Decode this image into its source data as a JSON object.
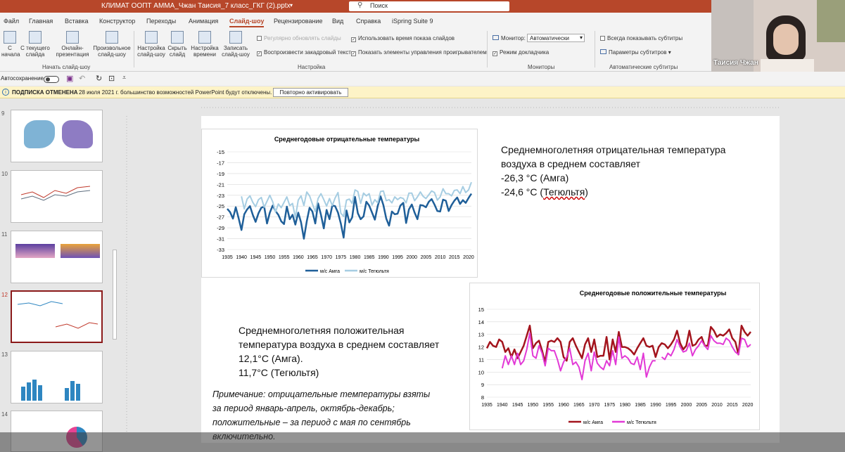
{
  "window": {
    "title": "КЛИМАТ ООПТ АММА_Чжан Таисия_7 класс_ГКГ (2).pptx",
    "search_placeholder": "Поиск"
  },
  "menu": {
    "tabs": [
      "Файл",
      "Главная",
      "Вставка",
      "Конструктор",
      "Переходы",
      "Анимация",
      "Слайд-шоу",
      "Рецензирование",
      "Вид",
      "Справка",
      "iSpring Suite 9"
    ],
    "active": "Слайд-шоу"
  },
  "ribbon": {
    "buttons": {
      "from_start": "С начала",
      "from_current": "С текущего слайда",
      "online": "Онлайн-презентация",
      "custom": "Произвольное слайд-шоу",
      "setup": "Настройка слайд-шоу",
      "hide": "Скрыть слайд",
      "rehearse": "Настройка времени",
      "record": "Записать слайд-шоу"
    },
    "checks": {
      "update": "Регулярно обновлять слайды",
      "voice": "Воспроизвести закадровый текст",
      "timings": "Использовать время показа слайдов",
      "controls": "Показать элементы управления проигрывателем",
      "monitor_label": "Монитор:",
      "monitor_value": "Автоматически",
      "presenter": "Режим докладчика",
      "subtitles": "Всегда показывать субтитры",
      "subtitle_params": "Параметры субтитров"
    },
    "groups": {
      "start": "Начать слайд-шоу",
      "setup": "Настройка",
      "monitors": "Мониторы",
      "subtitles": "Автоматические субтитры"
    }
  },
  "qat": {
    "autosave": "Автосохранение"
  },
  "notification": {
    "title": "ПОДПИСКА ОТМЕНЕНА",
    "message": "28 июля 2021 г. большинство возможностей PowerPoint будут отключены.",
    "button": "Повторно активировать"
  },
  "webcam": {
    "name": "Таисия Чжан"
  },
  "thumbnails": {
    "numbers": [
      "9",
      "10",
      "11",
      "12",
      "13",
      "14"
    ]
  },
  "slide": {
    "text_negative": [
      "Среднемноголетняя  отрицательная температура",
      "воздуха  в среднем составляет",
      "-26,3 °С  (Амга)",
      "-24,6 °С (Тегюльтя)"
    ],
    "text_positive": [
      "Среднемноголетняя  положительная",
      "температура воздуха в среднем составляет",
      "12,1°С (Амга).",
      "11,7°С (Тегюльтя)"
    ],
    "note": [
      "Примечание: отрицательные температуры взяты",
      "за период январь-апрель, октябрь-декабрь;",
      "положительные – за период с мая по сентябрь",
      "включительно."
    ]
  },
  "chart_data": [
    {
      "type": "line",
      "title": "Среднегодовые отрицательные температуры",
      "xlabel": "",
      "ylabel": "",
      "x_start": 1935,
      "x_end": 2021,
      "x_ticks": [
        1935,
        1940,
        1945,
        1950,
        1955,
        1960,
        1965,
        1970,
        1975,
        1980,
        1985,
        1990,
        1995,
        2000,
        2005,
        2010,
        2015,
        2020
      ],
      "ylim": [
        -33,
        -15
      ],
      "y_ticks": [
        -15,
        -17,
        -19,
        -21,
        -23,
        -25,
        -27,
        -29,
        -31,
        -33
      ],
      "grid": true,
      "legend": "bottom",
      "series": [
        {
          "name": "м/с Амга",
          "color": "#1f5f99",
          "width": 2.5,
          "values": [
            -25.5,
            -26.1,
            -27.3,
            -25.2,
            -27.2,
            -29.4,
            -26.5,
            -25.6,
            -25.0,
            -26.6,
            -27.9,
            -26.3,
            -25.3,
            -25.1,
            -28.2,
            -26.2,
            -24.9,
            -25.9,
            -26.6,
            -27.8,
            -28.3,
            -25.1,
            -27.4,
            -26.6,
            -28.4,
            -26.2,
            -28.0,
            -31.0,
            -27.8,
            -25.3,
            -26.0,
            -28.2,
            -24.5,
            -26.6,
            -29.1,
            -25.7,
            -27.4,
            -24.9,
            -25.0,
            -26.2,
            -28.2,
            -30.8,
            -25.8,
            -28.0,
            -27.1,
            -23.3,
            -26.3,
            -27.4,
            -26.9,
            -24.2,
            -24.9,
            -26.2,
            -27.5,
            -25.0,
            -23.2,
            -24.8,
            -27.3,
            -28.6,
            -26.0,
            -26.5,
            -26.4,
            -24.9,
            -24.4,
            -28.1,
            -25.6,
            -24.7,
            -26.2,
            -27.4,
            -24.8,
            -24.9,
            -25.2,
            -24.2,
            -23.7,
            -24.7,
            -25.9,
            -26.0,
            -23.8,
            -24.0,
            -25.9,
            -24.8,
            -24.0,
            -23.4,
            -24.6,
            -23.9,
            -24.4,
            -23.5,
            -22.7
          ]
        },
        {
          "name": "м/с Тегюльтя",
          "color": "#a6cde2",
          "width": 2,
          "values": [
            null,
            null,
            null,
            null,
            null,
            -23.2,
            -25.5,
            -23.7,
            -23.1,
            -24.3,
            -25.1,
            -23.8,
            -23.4,
            -25.2,
            -24.1,
            -23.0,
            -24.2,
            -26.1,
            -24.6,
            -25.3,
            -24.3,
            -23.3,
            -24.9,
            -24.5,
            -27.1,
            -23.9,
            -23.1,
            -24.9,
            -22.4,
            -23.1,
            -24.6,
            -26.0,
            -23.6,
            -22.7,
            -23.8,
            -25.0,
            -23.6,
            -24.9,
            -23.5,
            -22.5,
            -26.3,
            -26.9,
            -23.9,
            -23.7,
            -24.5,
            -22.0,
            -22.3,
            -24.5,
            -22.6,
            -23.1,
            -22.7,
            -24.8,
            -23.8,
            -24.4,
            -22.3,
            -22.2,
            -24.0,
            -23.8,
            -24.4,
            -23.3,
            -23.8,
            -23.4,
            -23.6,
            -24.4,
            -22.6,
            -22.6,
            -24.0,
            -23.3,
            -22.4,
            -23.2,
            -23.6,
            -22.9,
            -22.2,
            -22.5,
            -23.9,
            -23.3,
            -21.8,
            -22.7,
            -22.7,
            -23.1,
            -22.1,
            -22.0,
            -22.7,
            -21.4,
            -22.5,
            -22.0,
            -20.6
          ]
        }
      ]
    },
    {
      "type": "line",
      "title": "Среднегодовые положительные температуры",
      "xlabel": "",
      "ylabel": "",
      "x_start": 1935,
      "x_end": 2021,
      "x_ticks": [
        1935,
        1940,
        1945,
        1950,
        1955,
        1960,
        1965,
        1970,
        1975,
        1980,
        1985,
        1990,
        1995,
        2000,
        2005,
        2010,
        2015,
        2020
      ],
      "ylim": [
        8,
        15
      ],
      "y_ticks": [
        8,
        9,
        10,
        11,
        12,
        13,
        14,
        15
      ],
      "grid": true,
      "legend": "bottom",
      "series": [
        {
          "name": "м/с Амга",
          "color": "#a3141d",
          "width": 2.5,
          "values": [
            11.9,
            12.4,
            12.1,
            12.0,
            12.6,
            12.4,
            11.6,
            11.9,
            11.2,
            11.8,
            11.1,
            11.6,
            12.1,
            12.9,
            13.7,
            11.9,
            12.3,
            12.5,
            11.7,
            10.8,
            12.4,
            12.5,
            12.4,
            12.7,
            12.4,
            11.2,
            10.9,
            12.4,
            12.7,
            12.1,
            11.6,
            11.1,
            12.2,
            12.7,
            11.6,
            12.6,
            11.2,
            11.3,
            11.3,
            12.8,
            11.0,
            12.6,
            11.6,
            13.2,
            12.0,
            12.0,
            11.9,
            11.7,
            11.4,
            11.9,
            12.3,
            12.7,
            12.1,
            12.0,
            12.1,
            11.2,
            12.0,
            12.3,
            12.2,
            11.9,
            12.2,
            12.6,
            13.3,
            12.3,
            11.8,
            12.1,
            13.3,
            12.1,
            12.2,
            12.6,
            12.8,
            12.1,
            12.1,
            13.6,
            13.3,
            12.8,
            13.0,
            12.9,
            13.1,
            13.4,
            12.7,
            12.4,
            11.4,
            13.7,
            13.2,
            12.9,
            13.2
          ]
        },
        {
          "name": "м/с Тегюльтя",
          "color": "#e239d6",
          "width": 2,
          "values": [
            null,
            null,
            null,
            null,
            null,
            10.3,
            11.3,
            10.6,
            11.3,
            10.6,
            11.5,
            10.6,
            10.9,
            11.8,
            13.1,
            11.3,
            11.1,
            12.1,
            11.5,
            10.5,
            11.9,
            11.7,
            11.7,
            11.0,
            10.1,
            10.8,
            11.2,
            11.9,
            10.6,
            10.8,
            10.4,
            9.4,
            10.9,
            11.5,
            10.1,
            11.6,
            10.7,
            10.4,
            10.2,
            10.9,
            10.5,
            11.7,
            10.6,
            12.8,
            11.1,
            11.3,
            11.1,
            10.7,
            10.6,
            11.2,
            10.2,
            11.5,
            9.6,
            10.4,
            10.9,
            10.9,
            null,
            11.2,
            11.0,
            11.5,
            11.3,
            11.8,
            12.6,
            12.0,
            11.6,
            11.7,
            12.3,
            11.3,
            11.8,
            12.1,
            12.5,
            12.1,
            11.8,
            12.9,
            12.5,
            12.3,
            12.3,
            12.2,
            12.7,
            12.5,
            12.0,
            11.6,
            11.4,
            12.7,
            12.6,
            12.0,
            12.2
          ]
        }
      ]
    }
  ]
}
